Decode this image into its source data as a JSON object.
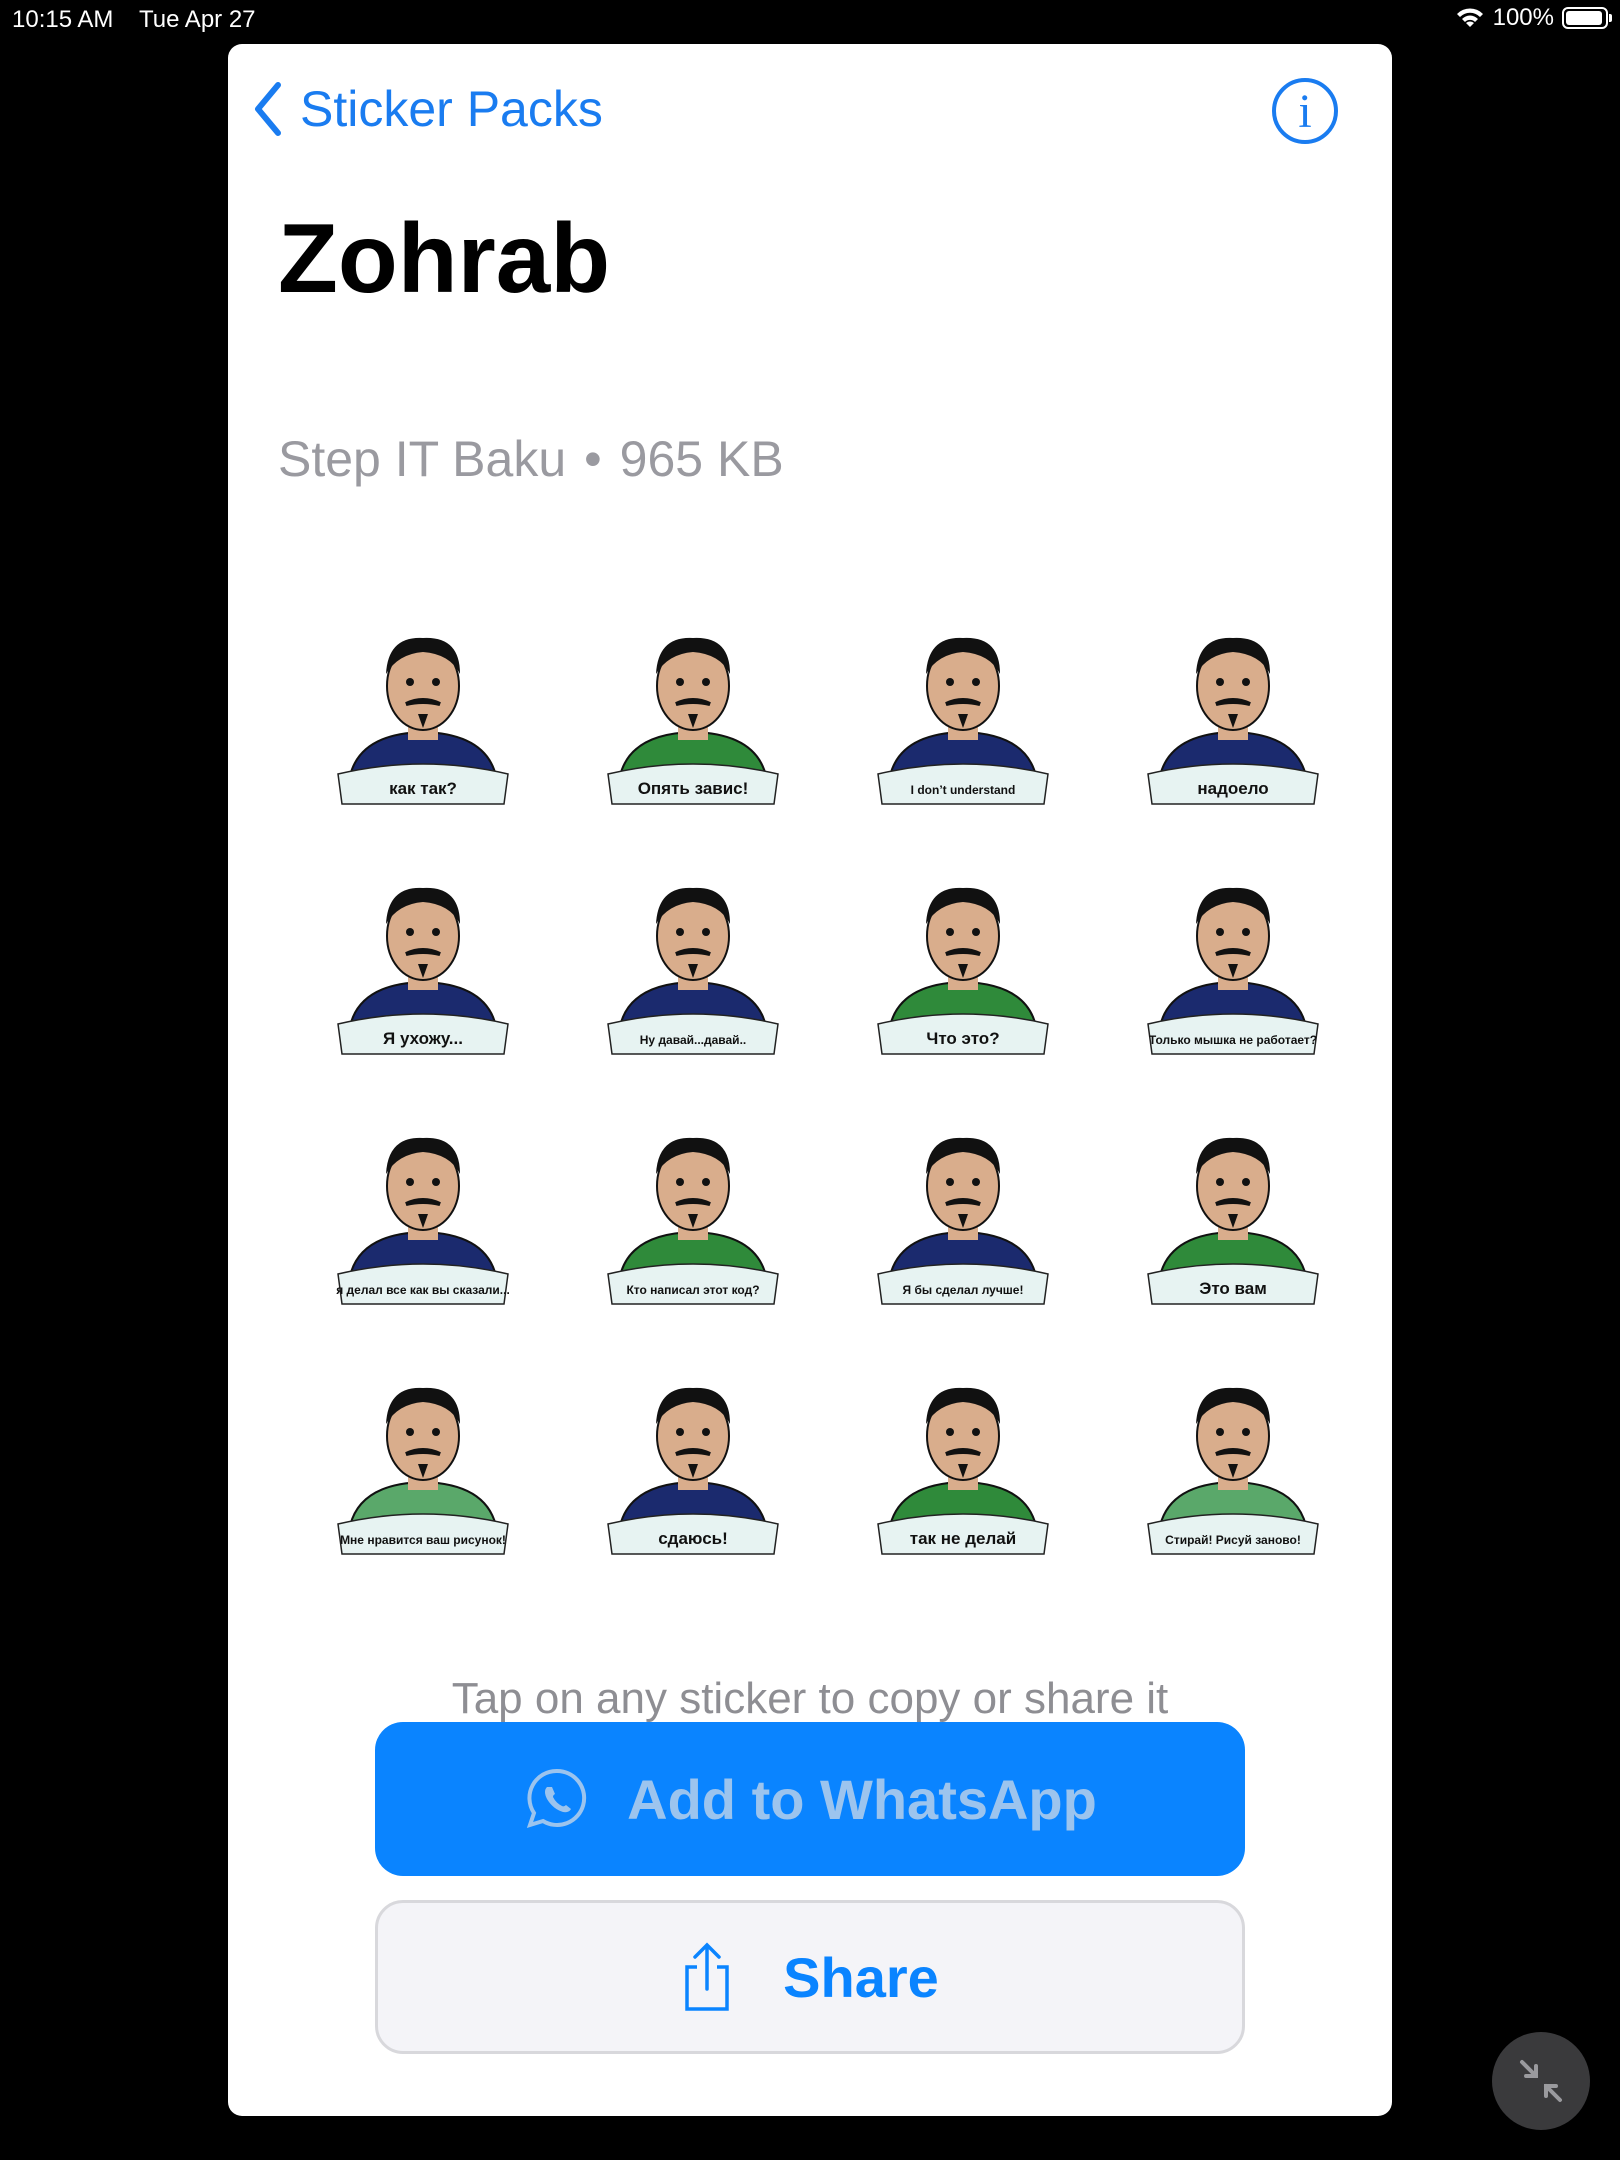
{
  "status": {
    "time": "10:15 AM",
    "date": "Tue Apr 27",
    "battery": "100%"
  },
  "nav": {
    "back_label": "Sticker Packs"
  },
  "pack": {
    "title": "Zohrab",
    "publisher": "Step IT Baku",
    "separator": "•",
    "size": "965 KB"
  },
  "stickers": [
    {
      "caption": "как так?",
      "shirt": "#1b2a6e"
    },
    {
      "caption": "Опять завис!",
      "shirt": "#2f8a3a"
    },
    {
      "caption": "I don’t understand",
      "shirt": "#1b2a6e"
    },
    {
      "caption": "надоело",
      "shirt": "#1b2a6e"
    },
    {
      "caption": "Я ухожу...",
      "shirt": "#1b2a6e"
    },
    {
      "caption": "Ну давай...давай..",
      "shirt": "#1b2a6e"
    },
    {
      "caption": "Что это?",
      "shirt": "#2f8a3a"
    },
    {
      "caption": "Только мышка не работает?",
      "shirt": "#1b2a6e"
    },
    {
      "caption": "я делал все как вы сказали...",
      "shirt": "#1b2a6e"
    },
    {
      "caption": "Кто написал этот код?",
      "shirt": "#2f8a3a"
    },
    {
      "caption": "Я бы сделал лучше!",
      "shirt": "#1b2a6e"
    },
    {
      "caption": "Это вам",
      "shirt": "#2f8a3a"
    },
    {
      "caption": "Мне нравится ваш рисунок!",
      "shirt": "#5aa86a"
    },
    {
      "caption": "сдаюсь!",
      "shirt": "#1b2a6e"
    },
    {
      "caption": "так не делай",
      "shirt": "#2f8a3a"
    },
    {
      "caption": "Стирай! Рисуй заново!",
      "shirt": "#5aa86a"
    }
  ],
  "hint": "Tap on any sticker to copy or share it",
  "buttons": {
    "add_label": "Add to WhatsApp",
    "share_label": "Share"
  },
  "icons": {
    "back": "chevron-left-icon",
    "info": "info-icon",
    "whatsapp": "whatsapp-icon",
    "share": "share-icon",
    "collapse": "collapse-arrows-icon"
  },
  "colors": {
    "accent": "#0a84ff",
    "link": "#1a7cf0",
    "muted": "#8e8e93"
  }
}
